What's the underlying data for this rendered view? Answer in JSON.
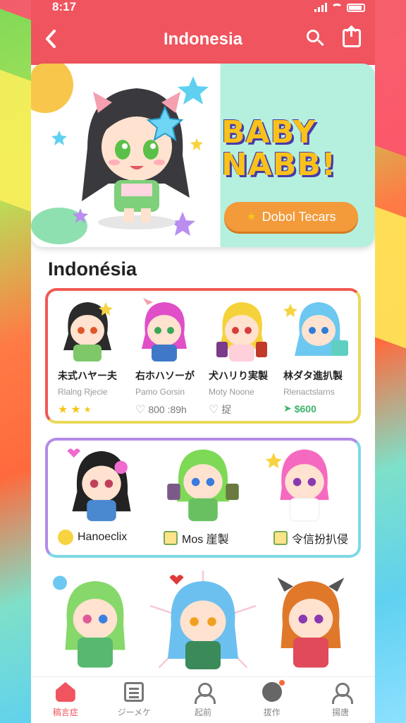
{
  "status_bar": {
    "time": "8:17"
  },
  "header": {
    "title": "Indonesia"
  },
  "banner": {
    "title_line1": "BABY",
    "title_line2": "NABB!",
    "button_label": "Dobol Tecars"
  },
  "section": {
    "title": "Indonésia"
  },
  "featured_items": [
    {
      "name": "未式ハヤー夫",
      "sub": "Rlalng Rjecie",
      "meta": "",
      "meta_type": "stars"
    },
    {
      "name": "右ホハソーが",
      "sub": "Pamo Gorsin",
      "meta": "800 :89h",
      "meta_type": "heart"
    },
    {
      "name": "犬ハリり実製",
      "sub": "Moty Noone",
      "meta": "捉",
      "meta_type": "heart"
    },
    {
      "name": "林ダタ進扒製",
      "sub": "Rlenactslarns",
      "meta": "$600",
      "meta_type": "money"
    }
  ],
  "row2_labels": [
    {
      "label": "Hanoeclix"
    },
    {
      "label": "Mos 崖製"
    },
    {
      "label": "令信扮扒侵"
    }
  ],
  "tabbar": [
    {
      "label": "稿言症",
      "icon": "home-icon",
      "active": true
    },
    {
      "label": "ジーメケ",
      "icon": "list-icon",
      "active": false
    },
    {
      "label": "起前",
      "icon": "user-icon",
      "active": false
    },
    {
      "label": "拔作",
      "icon": "game-icon",
      "active": false
    },
    {
      "label": "揚唐",
      "icon": "profile-icon",
      "active": false
    }
  ],
  "colors": {
    "accent": "#f0545e",
    "banner_button": "#f39a3b",
    "money": "#3bb36a"
  }
}
